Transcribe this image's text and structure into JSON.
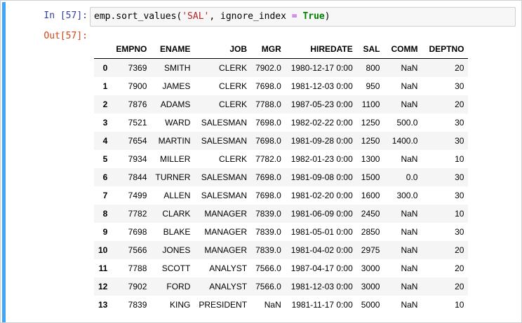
{
  "cell": {
    "in_prompt": "In [57]:",
    "out_prompt": "Out[57]:",
    "code": {
      "obj": "emp.sort_values(",
      "arg1": "'SAL'",
      "sep": ", ignore_index ",
      "eq": "=",
      "space": " ",
      "kw": "True",
      "close": ")"
    }
  },
  "colors": {
    "accent_bar": "#42a5f5",
    "in_prompt": "#303f9f",
    "out_prompt": "#d84315",
    "string": "#ba2121",
    "keyword": "#008000",
    "operator": "#aa22ff"
  },
  "table": {
    "index_header": "",
    "columns": [
      "EMPNO",
      "ENAME",
      "JOB",
      "MGR",
      "HIREDATE",
      "SAL",
      "COMM",
      "DEPTNO"
    ],
    "rows": [
      {
        "index": "0",
        "cells": [
          "7369",
          "SMITH",
          "CLERK",
          "7902.0",
          "1980-12-17 0:00",
          "800",
          "NaN",
          "20"
        ]
      },
      {
        "index": "1",
        "cells": [
          "7900",
          "JAMES",
          "CLERK",
          "7698.0",
          "1981-12-03 0:00",
          "950",
          "NaN",
          "30"
        ]
      },
      {
        "index": "2",
        "cells": [
          "7876",
          "ADAMS",
          "CLERK",
          "7788.0",
          "1987-05-23 0:00",
          "1100",
          "NaN",
          "20"
        ]
      },
      {
        "index": "3",
        "cells": [
          "7521",
          "WARD",
          "SALESMAN",
          "7698.0",
          "1982-02-22 0:00",
          "1250",
          "500.0",
          "30"
        ]
      },
      {
        "index": "4",
        "cells": [
          "7654",
          "MARTIN",
          "SALESMAN",
          "7698.0",
          "1981-09-28 0:00",
          "1250",
          "1400.0",
          "30"
        ]
      },
      {
        "index": "5",
        "cells": [
          "7934",
          "MILLER",
          "CLERK",
          "7782.0",
          "1982-01-23 0:00",
          "1300",
          "NaN",
          "10"
        ]
      },
      {
        "index": "6",
        "cells": [
          "7844",
          "TURNER",
          "SALESMAN",
          "7698.0",
          "1981-09-08 0:00",
          "1500",
          "0.0",
          "30"
        ]
      },
      {
        "index": "7",
        "cells": [
          "7499",
          "ALLEN",
          "SALESMAN",
          "7698.0",
          "1981-02-20 0:00",
          "1600",
          "300.0",
          "30"
        ]
      },
      {
        "index": "8",
        "cells": [
          "7782",
          "CLARK",
          "MANAGER",
          "7839.0",
          "1981-06-09 0:00",
          "2450",
          "NaN",
          "10"
        ]
      },
      {
        "index": "9",
        "cells": [
          "7698",
          "BLAKE",
          "MANAGER",
          "7839.0",
          "1981-05-01 0:00",
          "2850",
          "NaN",
          "30"
        ]
      },
      {
        "index": "10",
        "cells": [
          "7566",
          "JONES",
          "MANAGER",
          "7839.0",
          "1981-04-02 0:00",
          "2975",
          "NaN",
          "20"
        ]
      },
      {
        "index": "11",
        "cells": [
          "7788",
          "SCOTT",
          "ANALYST",
          "7566.0",
          "1987-04-17 0:00",
          "3000",
          "NaN",
          "20"
        ]
      },
      {
        "index": "12",
        "cells": [
          "7902",
          "FORD",
          "ANALYST",
          "7566.0",
          "1981-12-03 0:00",
          "3000",
          "NaN",
          "20"
        ]
      },
      {
        "index": "13",
        "cells": [
          "7839",
          "KING",
          "PRESIDENT",
          "NaN",
          "1981-11-17 0:00",
          "5000",
          "NaN",
          "10"
        ]
      }
    ]
  }
}
